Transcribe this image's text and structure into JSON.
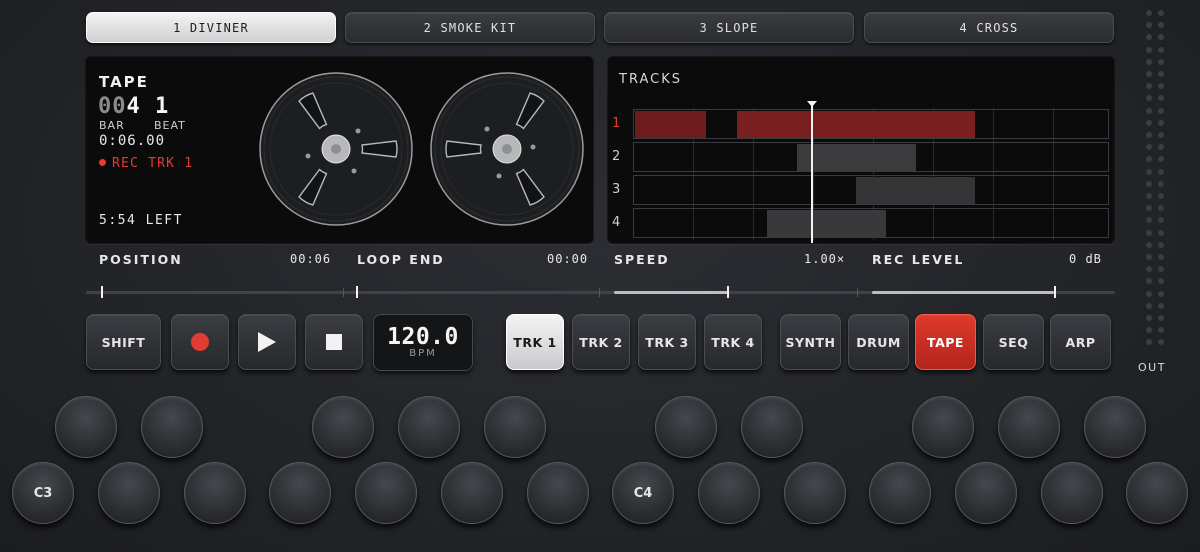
{
  "presets": [
    "1 DIVINER",
    "2 SMOKE KIT",
    "3 SLOPE",
    "4 CROSS"
  ],
  "active_preset_index": 0,
  "tape": {
    "title": "TAPE",
    "counter_dim": "00",
    "counter_bar": "4",
    "counter_beat": "1",
    "bar_label": "BAR",
    "beat_label": "BEAT",
    "time": "0:06.00",
    "rec_status": "REC TRK 1",
    "remaining": "5:54 LEFT"
  },
  "tracks": {
    "title": "TRACKS",
    "lanes": [
      {
        "num": "1",
        "recording": true
      },
      {
        "num": "2",
        "recording": false
      },
      {
        "num": "3",
        "recording": false
      },
      {
        "num": "4",
        "recording": false
      }
    ]
  },
  "params": {
    "position": {
      "label": "POSITION",
      "value": "00:06"
    },
    "loop_end": {
      "label": "LOOP END",
      "value": "00:00"
    },
    "speed": {
      "label": "SPEED",
      "value": "1.00×"
    },
    "rec_level": {
      "label": "REC LEVEL",
      "value": "0 dB"
    }
  },
  "transport": {
    "shift": "SHIFT",
    "bpm_value": "120.0",
    "bpm_unit": "BPM"
  },
  "track_buttons": [
    "TRK 1",
    "TRK 2",
    "TRK 3",
    "TRK 4"
  ],
  "active_track_index": 0,
  "mode_buttons": [
    "SYNTH",
    "DRUM",
    "TAPE",
    "SEQ",
    "ARP"
  ],
  "active_mode_index": 2,
  "keys": {
    "c3": "C3",
    "c4": "C4"
  },
  "out_label": "OUT",
  "colors": {
    "record_red": "#e23c32",
    "region_red": "#7a1d1d",
    "region_grey": "#3a3a3c"
  }
}
